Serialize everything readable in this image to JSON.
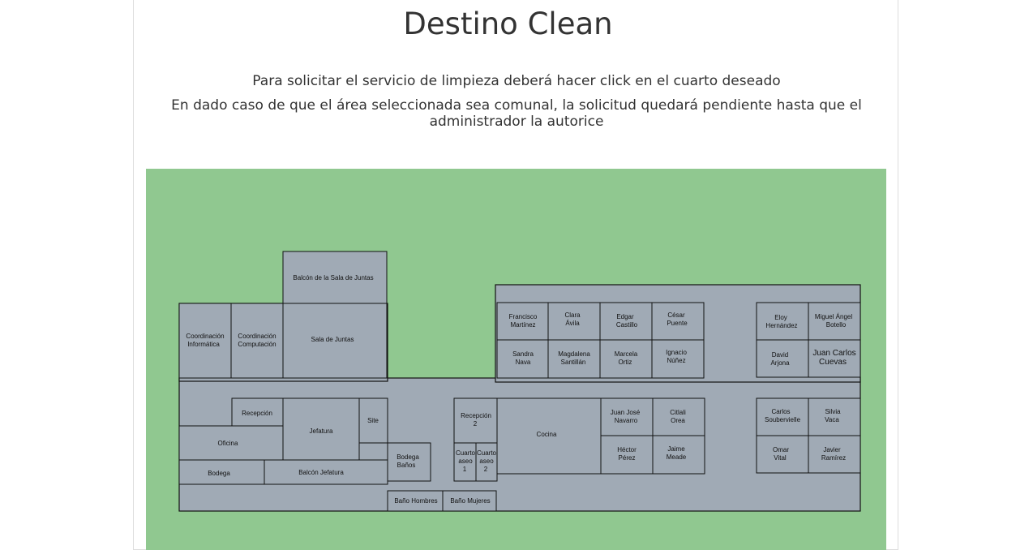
{
  "page": {
    "title": "Destino Clean",
    "instruction_1": "Para solicitar el servicio de limpieza deberá hacer click en el cuarto deseado",
    "instruction_2": "En dado caso de que el área seleccionada sea comunal, la solicitud quedará pendiente hasta que el administrador la autorice"
  },
  "colors": {
    "background": "#90c890",
    "room_fill": "#a0aab5",
    "wall": "#111111"
  },
  "rooms": {
    "balcon_sala_juntas": "Balcón de la Sala de Juntas",
    "coord_informatica": [
      "Coordinación",
      "Informática"
    ],
    "coord_computacion": [
      "Coordinación",
      "Computación"
    ],
    "sala_juntas": "Sala de Juntas",
    "recepcion": "Recepción",
    "jefatura": "Jefatura",
    "site": "Site",
    "oficina": "Oficina",
    "bodega": "Bodega",
    "balcon_jefatura": "Balcón Jefatura",
    "bodega_banos": [
      "Bodega",
      "Baños"
    ],
    "bano_hombres": "Baño Hombres",
    "bano_mujeres": "Baño Mujeres",
    "recepcion_2": [
      "Recepción",
      "2"
    ],
    "cuarto_aseo_1": [
      "Cuarto",
      "aseo",
      "1"
    ],
    "cuarto_aseo_2": [
      "Cuarto",
      "aseo",
      "2"
    ],
    "cocina": "Cocina",
    "francisco": [
      "Francisco",
      "Martínez"
    ],
    "clara": [
      "Clara",
      "Ávila"
    ],
    "edgar": [
      "Edgar",
      "Castillo"
    ],
    "cesar": [
      "César",
      "Puente"
    ],
    "sandra": [
      "Sandra",
      "Nava"
    ],
    "magdalena": [
      "Magdalena",
      "Santillán"
    ],
    "marcela": [
      "Marcela",
      "Ortiz"
    ],
    "ignacio": [
      "Ignacio",
      "Núñez"
    ],
    "juan_jose": [
      "Juan José",
      "Navarro"
    ],
    "citlali": [
      "Citlali",
      "Orea"
    ],
    "hector": [
      "Héctor",
      "Pérez"
    ],
    "jaime": [
      "Jaime",
      "Meade"
    ],
    "eloy": [
      "Eloy",
      "Hernández"
    ],
    "miguel": [
      "Miguel Ángel",
      "Botello"
    ],
    "david": [
      "David",
      "Arjona"
    ],
    "juan_carlos": [
      "Juan Carlos",
      "Cuevas"
    ],
    "carlos": [
      "Carlos",
      "Soubervielle"
    ],
    "silvia": [
      "Silvia",
      "Vaca"
    ],
    "omar": [
      "Omar",
      "Vital"
    ],
    "javier": [
      "Javier",
      "Ramírez"
    ]
  }
}
